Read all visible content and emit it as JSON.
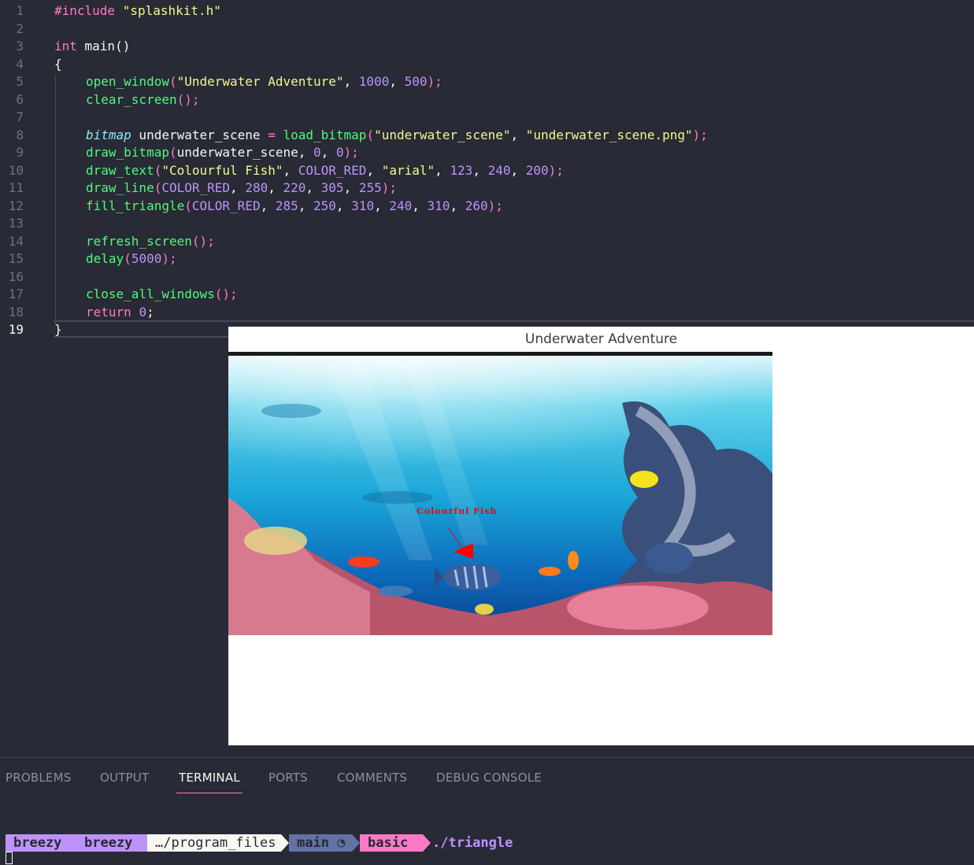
{
  "editor": {
    "line_numbers": [
      "1",
      "2",
      "3",
      "4",
      "5",
      "6",
      "7",
      "8",
      "9",
      "10",
      "11",
      "12",
      "13",
      "14",
      "15",
      "16",
      "17",
      "18",
      "19"
    ],
    "active_line": "19",
    "lines": {
      "l1": {
        "a": "#include ",
        "b": "\"splashkit.h\""
      },
      "l3": {
        "a": "int ",
        "b": "main",
        "c": "()"
      },
      "l4": {
        "a": "{"
      },
      "l5": {
        "a": "open_window",
        "b": "(",
        "c": "\"Underwater Adventure\"",
        "d": ", ",
        "e": "1000",
        "f": ", ",
        "g": "500",
        "h": ");"
      },
      "l6": {
        "a": "clear_screen",
        "b": "();"
      },
      "l8": {
        "a": "bitmap",
        "b": " underwater_scene ",
        "c": "=",
        "d": " ",
        "e": "load_bitmap",
        "f": "(",
        "g": "\"underwater_scene\"",
        "h": ", ",
        "i": "\"underwater_scene.png\"",
        "j": ");"
      },
      "l9": {
        "a": "draw_bitmap",
        "b": "(",
        "c": "underwater_scene",
        "d": ", ",
        "e": "0",
        "f": ", ",
        "g": "0",
        "h": ");"
      },
      "l10": {
        "a": "draw_text",
        "b": "(",
        "c": "\"Colourful Fish\"",
        "d": ", ",
        "e": "COLOR_RED",
        "f": ", ",
        "g": "\"arial\"",
        "h": ", ",
        "i": "123",
        "j": ", ",
        "k": "240",
        "l": ", ",
        "m": "200",
        "n": ");"
      },
      "l11": {
        "a": "draw_line",
        "b": "(",
        "c": "COLOR_RED",
        "d": ", ",
        "e": "280",
        "f": ", ",
        "g": "220",
        "h": ", ",
        "i": "305",
        "j": ", ",
        "k": "255",
        "l": ");"
      },
      "l12": {
        "a": "fill_triangle",
        "b": "(",
        "c": "COLOR_RED",
        "d": ", ",
        "e": "285",
        "f": ", ",
        "g": "250",
        "h": ", ",
        "i": "310",
        "j": ", ",
        "k": "240",
        "l": ", ",
        "m": "310",
        "n": ", ",
        "o": "260",
        "p": ");"
      },
      "l14": {
        "a": "refresh_screen",
        "b": "();"
      },
      "l15": {
        "a": "delay",
        "b": "(",
        "c": "5000",
        "d": ");"
      },
      "l17": {
        "a": "close_all_windows",
        "b": "();"
      },
      "l18": {
        "a": "return ",
        "b": "0",
        "c": ";"
      },
      "l19": {
        "a": "}"
      }
    }
  },
  "app_window": {
    "title": "Underwater Adventure",
    "canvas_text": "Colourful Fish",
    "text_color": "#ff0000"
  },
  "panel": {
    "tabs": [
      "PROBLEMS",
      "OUTPUT",
      "TERMINAL",
      "PORTS",
      "COMMENTS",
      "DEBUG CONSOLE"
    ],
    "active_tab": "TERMINAL"
  },
  "terminal": {
    "prompt_segments": [
      "breezy",
      "breezy",
      "…/program_files",
      "main ◔",
      "basic"
    ],
    "segment_colors": [
      "#bd93f9",
      "#bd93f9",
      "#f8f8f2",
      "#6272a4",
      "#ff79c6"
    ],
    "command": "./triangle"
  },
  "icons": {
    "branch_status": "clock-icon"
  }
}
